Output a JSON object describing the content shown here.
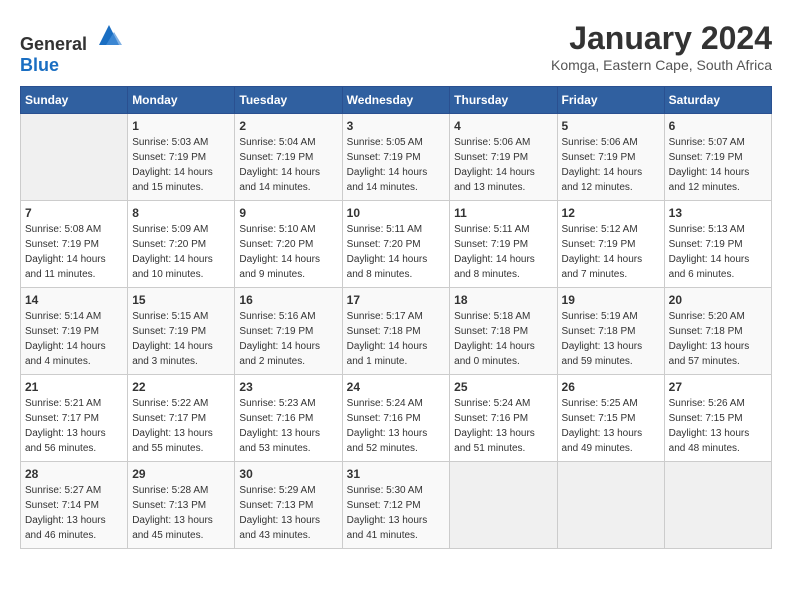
{
  "header": {
    "logo_general": "General",
    "logo_blue": "Blue",
    "title": "January 2024",
    "subtitle": "Komga, Eastern Cape, South Africa"
  },
  "calendar": {
    "days_of_week": [
      "Sunday",
      "Monday",
      "Tuesday",
      "Wednesday",
      "Thursday",
      "Friday",
      "Saturday"
    ],
    "weeks": [
      [
        {
          "day": "",
          "info": ""
        },
        {
          "day": "1",
          "info": "Sunrise: 5:03 AM\nSunset: 7:19 PM\nDaylight: 14 hours\nand 15 minutes."
        },
        {
          "day": "2",
          "info": "Sunrise: 5:04 AM\nSunset: 7:19 PM\nDaylight: 14 hours\nand 14 minutes."
        },
        {
          "day": "3",
          "info": "Sunrise: 5:05 AM\nSunset: 7:19 PM\nDaylight: 14 hours\nand 14 minutes."
        },
        {
          "day": "4",
          "info": "Sunrise: 5:06 AM\nSunset: 7:19 PM\nDaylight: 14 hours\nand 13 minutes."
        },
        {
          "day": "5",
          "info": "Sunrise: 5:06 AM\nSunset: 7:19 PM\nDaylight: 14 hours\nand 12 minutes."
        },
        {
          "day": "6",
          "info": "Sunrise: 5:07 AM\nSunset: 7:19 PM\nDaylight: 14 hours\nand 12 minutes."
        }
      ],
      [
        {
          "day": "7",
          "info": "Sunrise: 5:08 AM\nSunset: 7:19 PM\nDaylight: 14 hours\nand 11 minutes."
        },
        {
          "day": "8",
          "info": "Sunrise: 5:09 AM\nSunset: 7:20 PM\nDaylight: 14 hours\nand 10 minutes."
        },
        {
          "day": "9",
          "info": "Sunrise: 5:10 AM\nSunset: 7:20 PM\nDaylight: 14 hours\nand 9 minutes."
        },
        {
          "day": "10",
          "info": "Sunrise: 5:11 AM\nSunset: 7:20 PM\nDaylight: 14 hours\nand 8 minutes."
        },
        {
          "day": "11",
          "info": "Sunrise: 5:11 AM\nSunset: 7:19 PM\nDaylight: 14 hours\nand 8 minutes."
        },
        {
          "day": "12",
          "info": "Sunrise: 5:12 AM\nSunset: 7:19 PM\nDaylight: 14 hours\nand 7 minutes."
        },
        {
          "day": "13",
          "info": "Sunrise: 5:13 AM\nSunset: 7:19 PM\nDaylight: 14 hours\nand 6 minutes."
        }
      ],
      [
        {
          "day": "14",
          "info": "Sunrise: 5:14 AM\nSunset: 7:19 PM\nDaylight: 14 hours\nand 4 minutes."
        },
        {
          "day": "15",
          "info": "Sunrise: 5:15 AM\nSunset: 7:19 PM\nDaylight: 14 hours\nand 3 minutes."
        },
        {
          "day": "16",
          "info": "Sunrise: 5:16 AM\nSunset: 7:19 PM\nDaylight: 14 hours\nand 2 minutes."
        },
        {
          "day": "17",
          "info": "Sunrise: 5:17 AM\nSunset: 7:18 PM\nDaylight: 14 hours\nand 1 minute."
        },
        {
          "day": "18",
          "info": "Sunrise: 5:18 AM\nSunset: 7:18 PM\nDaylight: 14 hours\nand 0 minutes."
        },
        {
          "day": "19",
          "info": "Sunrise: 5:19 AM\nSunset: 7:18 PM\nDaylight: 13 hours\nand 59 minutes."
        },
        {
          "day": "20",
          "info": "Sunrise: 5:20 AM\nSunset: 7:18 PM\nDaylight: 13 hours\nand 57 minutes."
        }
      ],
      [
        {
          "day": "21",
          "info": "Sunrise: 5:21 AM\nSunset: 7:17 PM\nDaylight: 13 hours\nand 56 minutes."
        },
        {
          "day": "22",
          "info": "Sunrise: 5:22 AM\nSunset: 7:17 PM\nDaylight: 13 hours\nand 55 minutes."
        },
        {
          "day": "23",
          "info": "Sunrise: 5:23 AM\nSunset: 7:16 PM\nDaylight: 13 hours\nand 53 minutes."
        },
        {
          "day": "24",
          "info": "Sunrise: 5:24 AM\nSunset: 7:16 PM\nDaylight: 13 hours\nand 52 minutes."
        },
        {
          "day": "25",
          "info": "Sunrise: 5:24 AM\nSunset: 7:16 PM\nDaylight: 13 hours\nand 51 minutes."
        },
        {
          "day": "26",
          "info": "Sunrise: 5:25 AM\nSunset: 7:15 PM\nDaylight: 13 hours\nand 49 minutes."
        },
        {
          "day": "27",
          "info": "Sunrise: 5:26 AM\nSunset: 7:15 PM\nDaylight: 13 hours\nand 48 minutes."
        }
      ],
      [
        {
          "day": "28",
          "info": "Sunrise: 5:27 AM\nSunset: 7:14 PM\nDaylight: 13 hours\nand 46 minutes."
        },
        {
          "day": "29",
          "info": "Sunrise: 5:28 AM\nSunset: 7:13 PM\nDaylight: 13 hours\nand 45 minutes."
        },
        {
          "day": "30",
          "info": "Sunrise: 5:29 AM\nSunset: 7:13 PM\nDaylight: 13 hours\nand 43 minutes."
        },
        {
          "day": "31",
          "info": "Sunrise: 5:30 AM\nSunset: 7:12 PM\nDaylight: 13 hours\nand 41 minutes."
        },
        {
          "day": "",
          "info": ""
        },
        {
          "day": "",
          "info": ""
        },
        {
          "day": "",
          "info": ""
        }
      ]
    ]
  }
}
